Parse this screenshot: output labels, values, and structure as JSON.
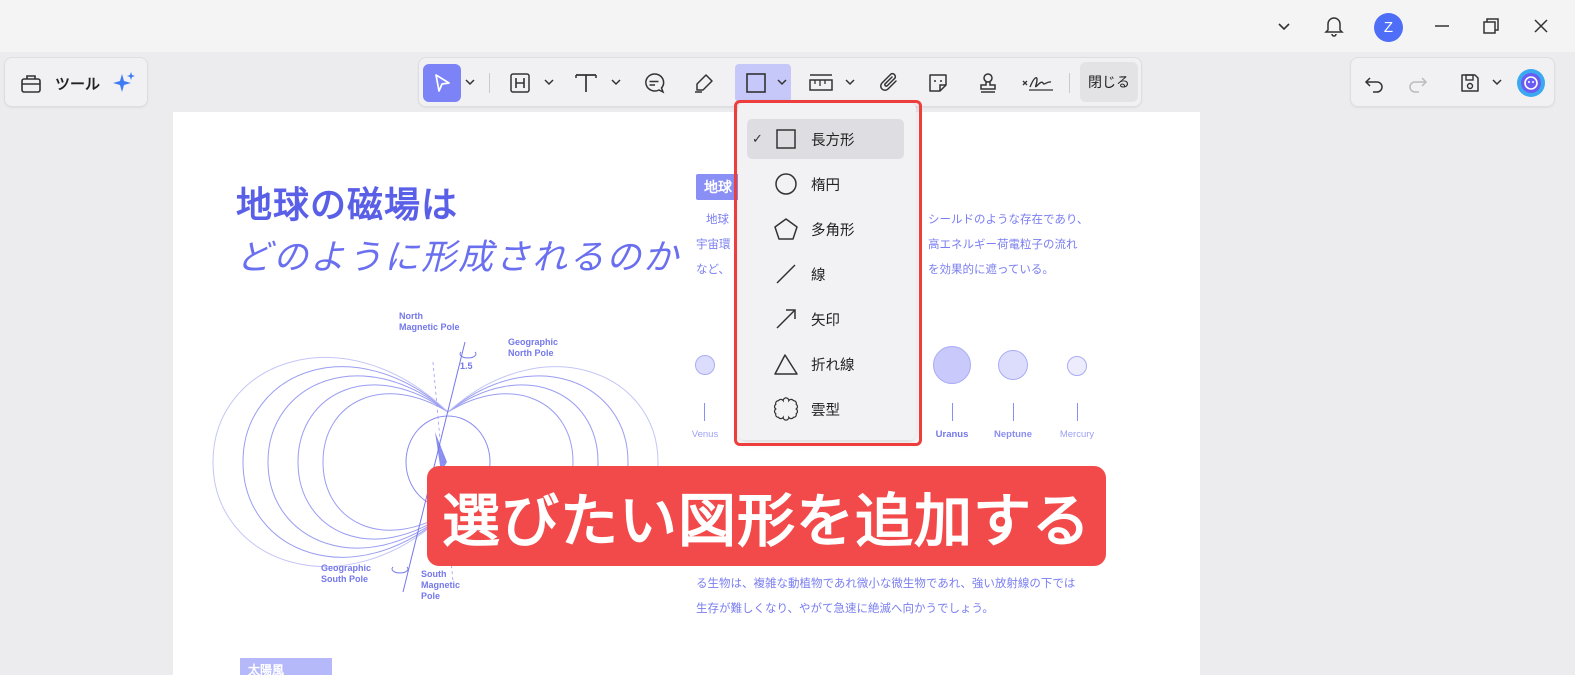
{
  "titlebar": {
    "avatar_letter": "Z",
    "icons": [
      "chevron-down-icon",
      "bell-icon",
      "minimize-icon",
      "restore-icon",
      "close-icon"
    ]
  },
  "toolbar_left": {
    "tools_label": "ツール"
  },
  "toolbar_mid": {
    "close_label": "閉じる",
    "icons": [
      "select-icon",
      "highlight-icon",
      "text-icon",
      "comment-icon",
      "pen-icon",
      "rectangle-icon",
      "measure-icon",
      "attach-icon",
      "sticker-icon",
      "stamp-icon",
      "signature-icon"
    ]
  },
  "toolbar_right": {
    "icons": [
      "undo-icon",
      "redo-icon",
      "save-icon",
      "ai-assistant-icon"
    ]
  },
  "shape_menu": {
    "items": [
      {
        "label": "長方形",
        "icon": "rectangle-icon",
        "selected": true
      },
      {
        "label": "楕円",
        "icon": "ellipse-icon",
        "selected": false
      },
      {
        "label": "多角形",
        "icon": "polygon-icon",
        "selected": false
      },
      {
        "label": "線",
        "icon": "line-icon",
        "selected": false
      },
      {
        "label": "矢印",
        "icon": "arrow-icon",
        "selected": false
      },
      {
        "label": "折れ線",
        "icon": "polyline-icon",
        "selected": false
      },
      {
        "label": "雲型",
        "icon": "cloud-icon",
        "selected": false
      }
    ],
    "check_mark": "✓"
  },
  "document": {
    "title_line1": "地球の磁場は",
    "title_line2": "どのように形成されるのか",
    "tag": "地球",
    "para1": [
      "地球",
      "シールドのような存在であり、",
      "宇宙環",
      "高エネルギー荷電粒子の流れ",
      "など、",
      "を効果的に遮っている。"
    ],
    "para2": [
      "る生物は、複雑な動植物であれ微小な微生物であれ、強い放射線の下では",
      "生存が難しくなり、やがて急速に絶滅へ向かうでしょう。"
    ],
    "planets": [
      {
        "name": "Venus",
        "size": 20
      },
      {
        "name": "Uranus",
        "size": 38
      },
      {
        "name": "Neptune",
        "size": 30
      },
      {
        "name": "Mercury",
        "size": 20
      }
    ],
    "diagram_labels": {
      "north_magnetic": "North\nMagnetic Pole",
      "geographic_north": "Geographic\nNorth Pole",
      "angle": "1.5",
      "geographic_south": "Geographic\nSouth Pole",
      "south_magnetic": "South\nMagnetic\nPole"
    },
    "bottom_tag": "太陽風"
  },
  "banner": {
    "text": "選びたい図形を追加する"
  },
  "colors": {
    "accent": "#7b83f7",
    "banner": "#f24a4a",
    "highlight_frame": "#ee3d3d",
    "doc_text": "#5a5fe8"
  }
}
